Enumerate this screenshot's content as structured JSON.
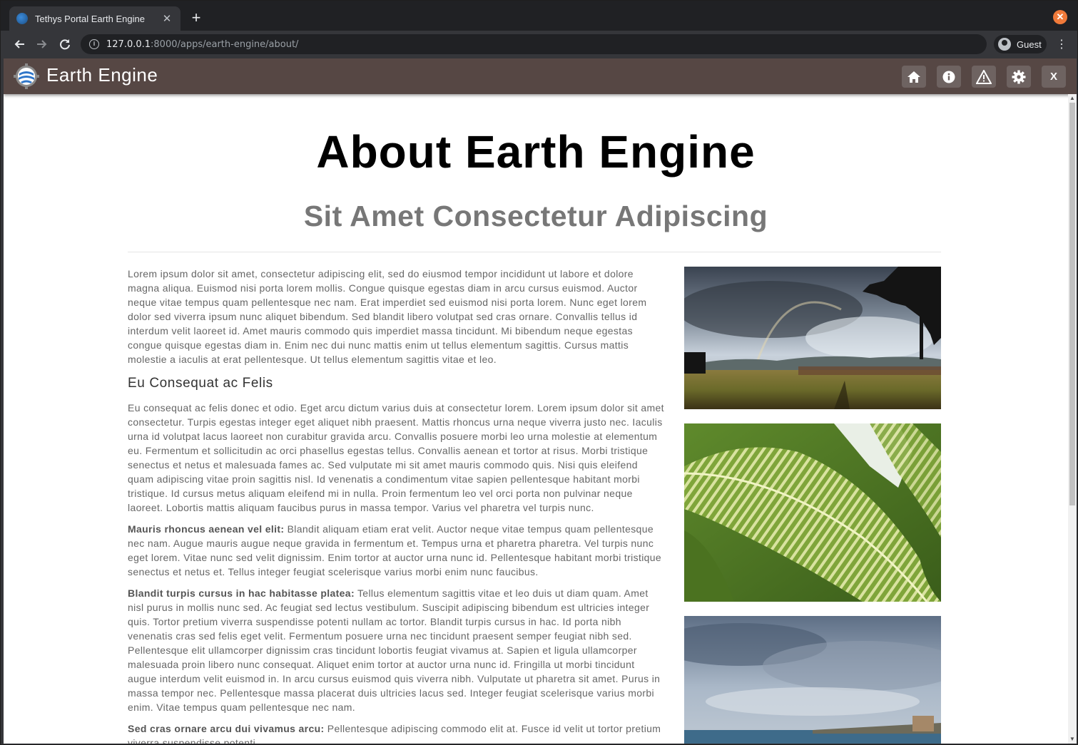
{
  "browser": {
    "tab_title": "Tethys Portal Earth Engine",
    "tab_close": "✕",
    "new_tab": "+",
    "url_host": "127.0.0.1",
    "url_rest": ":8000/apps/earth-engine/about/",
    "profile_label": "Guest",
    "window_close": "✕"
  },
  "app": {
    "title": "Earth Engine",
    "header_buttons": [
      "home-icon",
      "info-icon",
      "warning-icon",
      "gear-icon",
      "close-icon"
    ],
    "exit_label": "X",
    "colors": {
      "header_bg": "#564744",
      "button_bg": "#6e6361"
    }
  },
  "page": {
    "title": "About Earth Engine",
    "subtitle": "Sit Amet Consectetur Adipiscing",
    "intro": "Lorem ipsum dolor sit amet, consectetur adipiscing elit, sed do eiusmod tempor incididunt ut labore et dolore magna aliqua. Euismod nisi porta lorem mollis. Congue quisque egestas diam in arcu cursus euismod. Auctor neque vitae tempus quam pellentesque nec nam. Erat imperdiet sed euismod nisi porta lorem. Nunc eget lorem dolor sed viverra ipsum nunc aliquet bibendum. Sed blandit libero volutpat sed cras ornare. Convallis tellus id interdum velit laoreet id. Amet mauris commodo quis imperdiet massa tincidunt. Mi bibendum neque egestas congue quisque egestas diam in. Enim nec dui nunc mattis enim ut tellus elementum sagittis. Cursus mattis molestie a iaculis at erat pellentesque. Ut tellus elementum sagittis vitae et leo.",
    "section_heading": "Eu Consequat ac Felis",
    "section_para": "Eu consequat ac felis donec et odio. Eget arcu dictum varius duis at consectetur lorem. Lorem ipsum dolor sit amet consectetur. Turpis egestas integer eget aliquet nibh praesent. Mattis rhoncus urna neque viverra justo nec. Iaculis urna id volutpat lacus laoreet non curabitur gravida arcu. Convallis posuere morbi leo urna molestie at elementum eu. Fermentum et sollicitudin ac orci phasellus egestas tellus. Convallis aenean et tortor at risus. Morbi tristique senectus et netus et malesuada fames ac. Sed vulputate mi sit amet mauris commodo quis. Nisi quis eleifend quam adipiscing vitae proin sagittis nisl. Id venenatis a condimentum vitae sapien pellentesque habitant morbi tristique. Id cursus metus aliquam eleifend mi in nulla. Proin fermentum leo vel orci porta non pulvinar neque laoreet. Lobortis mattis aliquam faucibus purus in massa tempor. Varius vel pharetra vel turpis nunc.",
    "items": [
      {
        "lead": "Mauris rhoncus aenean vel elit:",
        "text": " Blandit aliquam etiam erat velit. Auctor neque vitae tempus quam pellentesque nec nam. Augue mauris augue neque gravida in fermentum et. Tempus urna et pharetra pharetra. Vel turpis nunc eget lorem. Vitae nunc sed velit dignissim. Enim tortor at auctor urna nunc id. Pellentesque habitant morbi tristique senectus et netus et. Tellus integer feugiat scelerisque varius morbi enim nunc faucibus."
      },
      {
        "lead": "Blandit turpis cursus in hac habitasse platea:",
        "text": " Tellus elementum sagittis vitae et leo duis ut diam quam. Amet nisl purus in mollis nunc sed. Ac feugiat sed lectus vestibulum. Suscipit adipiscing bibendum est ultricies integer quis. Tortor pretium viverra suspendisse potenti nullam ac tortor. Blandit turpis cursus in hac. Id porta nibh venenatis cras sed felis eget velit. Fermentum posuere urna nec tincidunt praesent semper feugiat nibh sed. Pellentesque elit ullamcorper dignissim cras tincidunt lobortis feugiat vivamus at. Sapien et ligula ullamcorper malesuada proin libero nunc consequat. Aliquet enim tortor at auctor urna nunc id. Fringilla ut morbi tincidunt augue interdum velit euismod in. In arcu cursus euismod quis viverra nibh. Vulputate ut pharetra sit amet. Purus in massa tempor nec. Pellentesque massa placerat duis ultricies lacus sed. Integer feugiat scelerisque varius morbi enim. Vitae tempus quam pellentesque nec nam."
      },
      {
        "lead": "Sed cras ornare arcu dui vivamus arcu:",
        "text": " Pellentesque adipiscing commodo elit at. Fusce id velit ut tortor pretium viverra suspendisse potenti."
      }
    ],
    "images": [
      "landscape-rainbow-photo",
      "striped-leaf-photo",
      "cloudy-coast-photo"
    ]
  }
}
